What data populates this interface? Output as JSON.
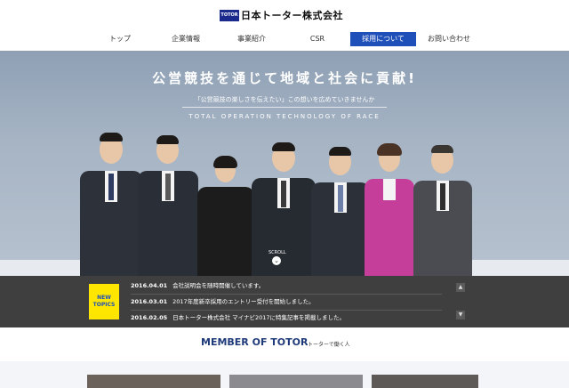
{
  "header": {
    "logo_mark": "TOTOR",
    "logo_text": "日本トーター株式会社"
  },
  "nav": {
    "items": [
      {
        "label": "トップ"
      },
      {
        "label": "企業情報"
      },
      {
        "label": "事業紹介"
      },
      {
        "label": "CSR"
      },
      {
        "label": "採用について",
        "active": true
      },
      {
        "label": "お問い合わせ"
      }
    ]
  },
  "hero": {
    "title": "公営競技を通じて地域と社会に貢献!",
    "subtitle": "「公営競技の楽しさを伝えたい」この想いを広めていきませんか",
    "tagline": "TOTAL OPERATION TECHNOLOGY OF RACE",
    "scroll_label": "SCROLL",
    "scroll_icon": "⌄"
  },
  "news": {
    "badge": "NEW TOPICS",
    "items": [
      {
        "date": "2016.04.01",
        "text": "会社説明会を随時開催しています。"
      },
      {
        "date": "2016.03.01",
        "text": "2017年度新卒採用のエントリー受付を開始しました。"
      },
      {
        "date": "2016.02.05",
        "text": "日本トーター株式会社 マイナビ2017に特集記事を掲載しました。"
      }
    ],
    "up_icon": "▲",
    "down_icon": "▼"
  },
  "member": {
    "title": "MEMBER OF TOTOR",
    "subtitle": "トーターで働く人"
  },
  "colors": {
    "accent": "#1f4fb8",
    "news_bg": "#3f3f3f",
    "badge": "#ffe600"
  }
}
